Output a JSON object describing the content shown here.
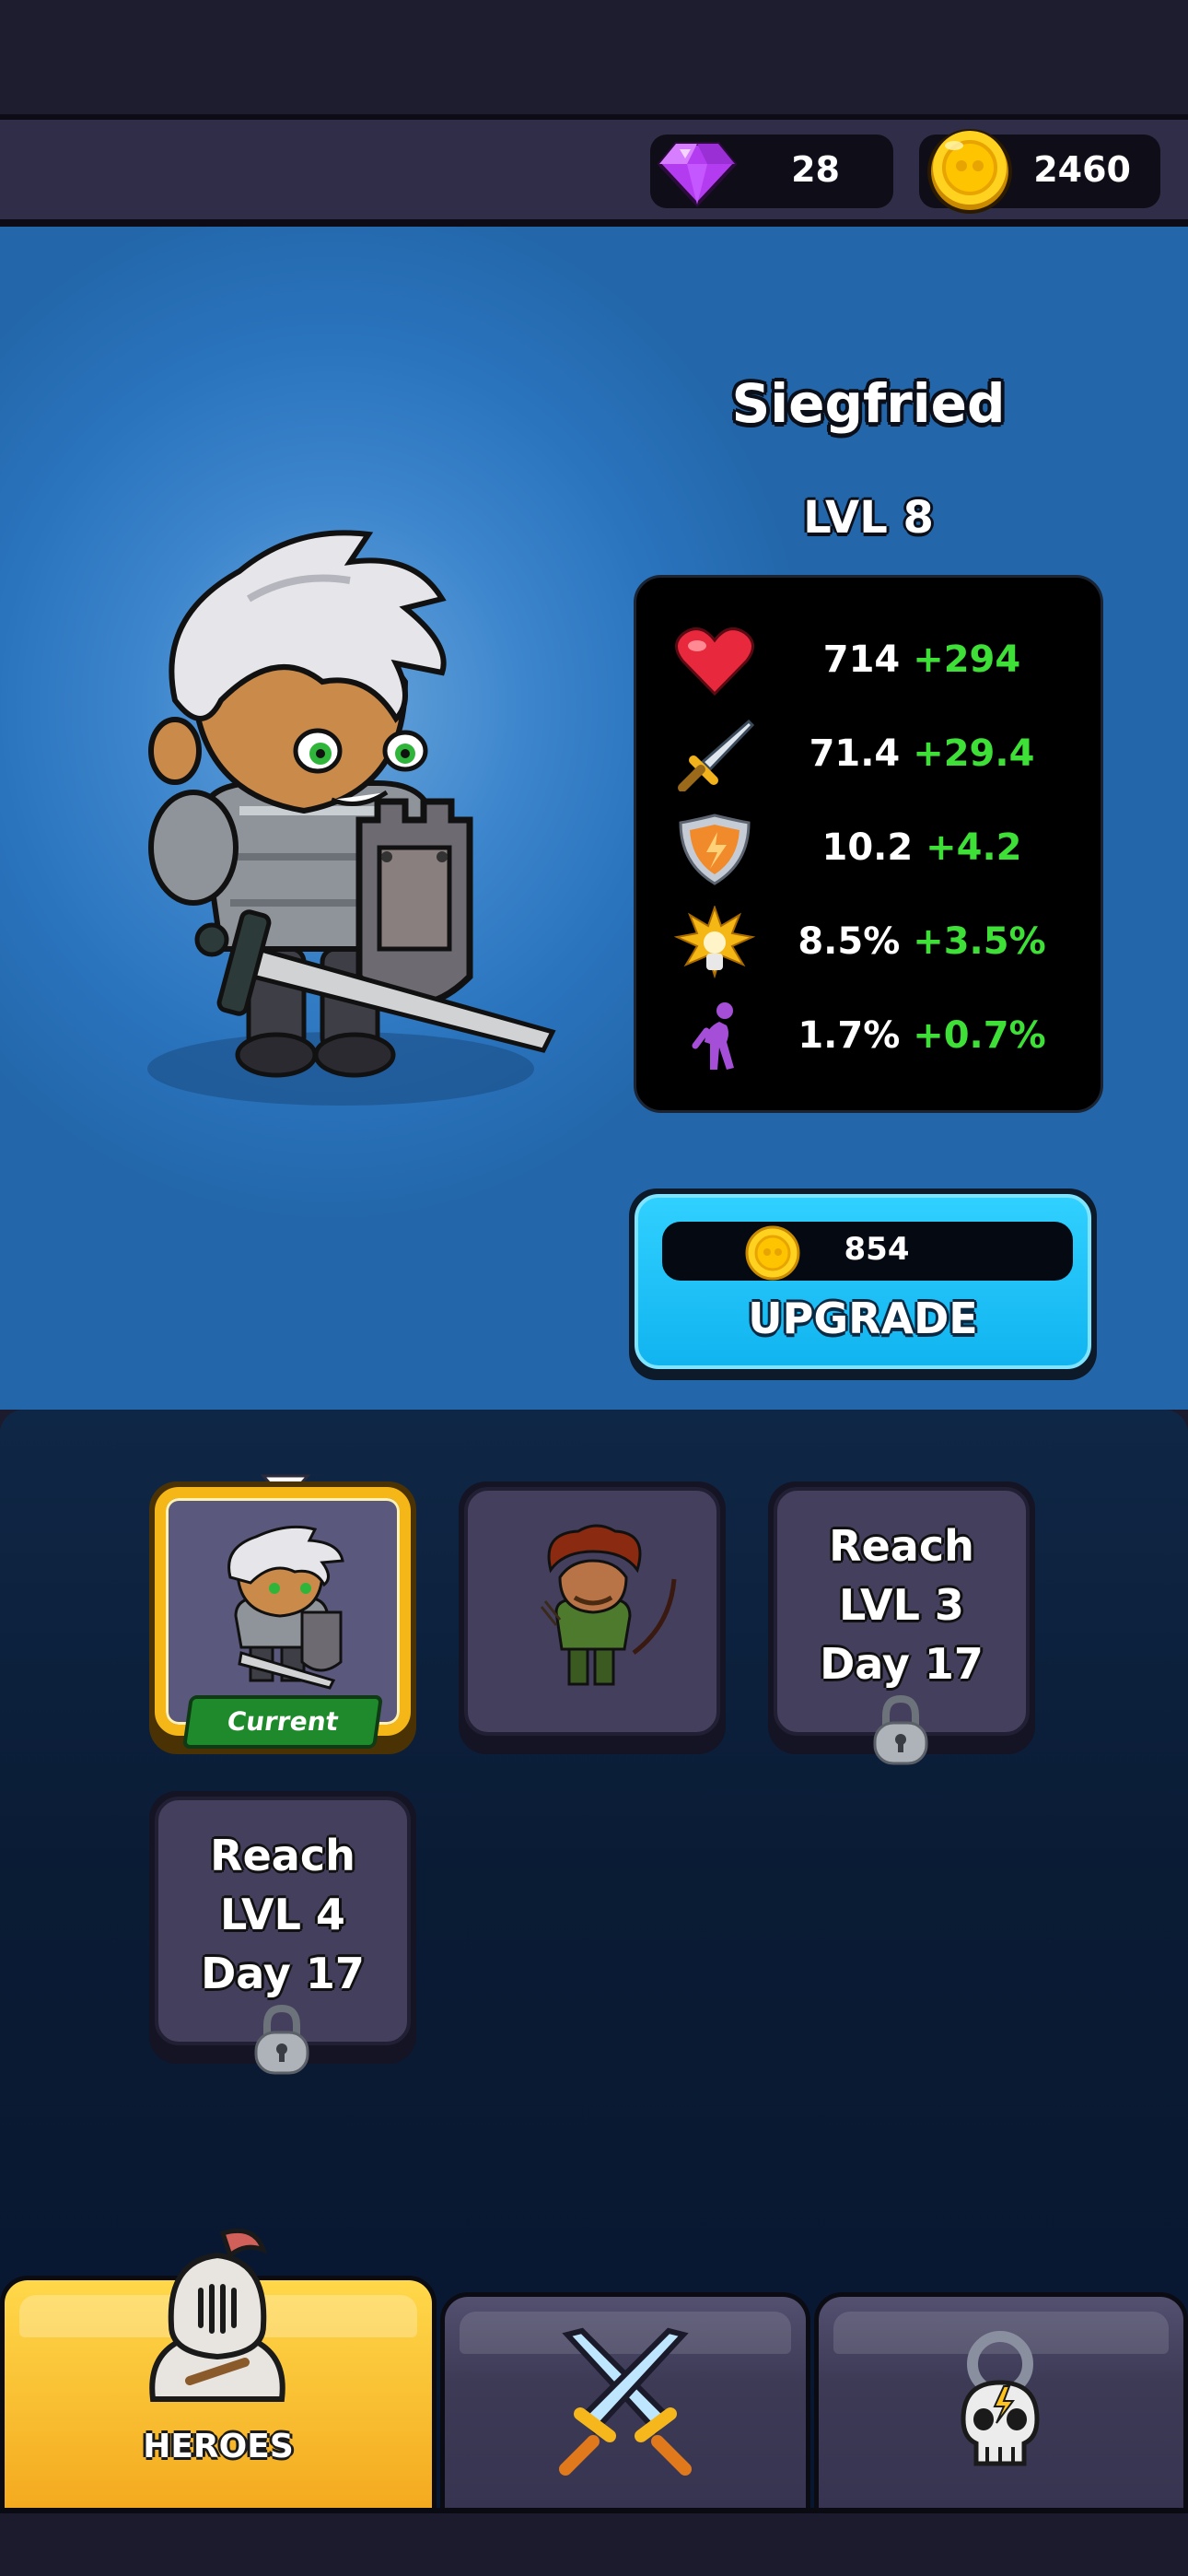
{
  "currency": {
    "gems": "28",
    "coins": "2460"
  },
  "hero": {
    "name": "Siegfried",
    "level": "LVL 8"
  },
  "stats": [
    {
      "icon": "heart-icon",
      "base": "714",
      "bonus": "+294"
    },
    {
      "icon": "sword-icon",
      "base": "71.4",
      "bonus": "+29.4"
    },
    {
      "icon": "shield-icon",
      "base": "10.2",
      "bonus": "+4.2"
    },
    {
      "icon": "critical-hit-icon",
      "base": "8.5%",
      "bonus": "+3.5%"
    },
    {
      "icon": "dodge-icon",
      "base": "1.7%",
      "bonus": "+0.7%"
    }
  ],
  "upgrade": {
    "cost": "854",
    "label": "UPGRADE"
  },
  "roster": {
    "current_badge": "Current",
    "locked": [
      {
        "line1": "Reach",
        "line2": "LVL 3",
        "line3": "Day 17"
      },
      {
        "line1": "Reach",
        "line2": "LVL 4",
        "line3": "Day 17"
      }
    ]
  },
  "nav": {
    "heroes_label": "HEROES"
  },
  "colors": {
    "bonus_green": "#3ee038",
    "selected_gold": "#f5b718",
    "upgrade_blue": "#11b4f0",
    "heroes_tab_yellow": "#f4a91e"
  }
}
